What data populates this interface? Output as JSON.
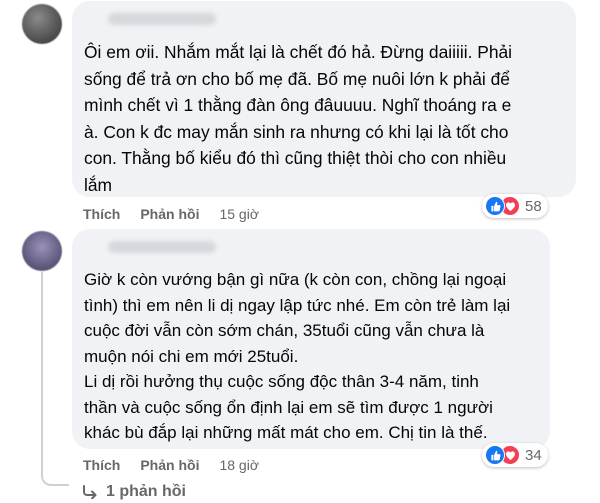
{
  "comments": [
    {
      "lines": [
        "Ôi em ơii. Nhắm mắt lại là chết đó hả. Đừng daiiiii. Phải",
        "sống để trả ơn cho bố mẹ đã. Bố mẹ nuôi lớn k phải để",
        "mình chết vì 1 thằng đàn ông đâuuuu. Nghĩ thoáng ra e",
        "à. Con k đc may mắn sinh ra nhưng có khi lại là tốt cho",
        "con. Thằng bố kiểu đó thì cũng thiệt thòi cho con nhiều",
        "lắm"
      ],
      "like_label": "Thích",
      "reply_label": "Phản hồi",
      "time": "15 giờ",
      "reaction_count": "58"
    },
    {
      "lines": [
        "Giờ k còn vướng bận gì nữa (k còn con, chồng lại ngoại",
        "tình) thì em nên li dị ngay lập tức nhé. Em còn trẻ làm lại",
        "cuộc đời vẫn còn sớm chán, 35tuổi cũng vẫn chưa là",
        "muộn nói chi em mới 25tuổi.",
        "Li dị rồi hưởng thụ cuộc sống độc thân 3-4 năm, tinh",
        "thần và cuộc sống ổn định lại em sẽ tìm được 1 người",
        "khác bù đắp lại những mất mát cho em. Chị tin là thế."
      ],
      "like_label": "Thích",
      "reply_label": "Phản hồi",
      "time": "18 giờ",
      "reaction_count": "34"
    }
  ],
  "replies_label": "1 phản hồi",
  "icons": {
    "like": "like-icon",
    "love": "love-icon",
    "reply_arrow": "reply-arrow-icon"
  },
  "colors": {
    "bubble": "#f0f2f5",
    "secondary_text": "#65676b",
    "like_blue": "#1877f2",
    "love_red": "#f33e58"
  }
}
